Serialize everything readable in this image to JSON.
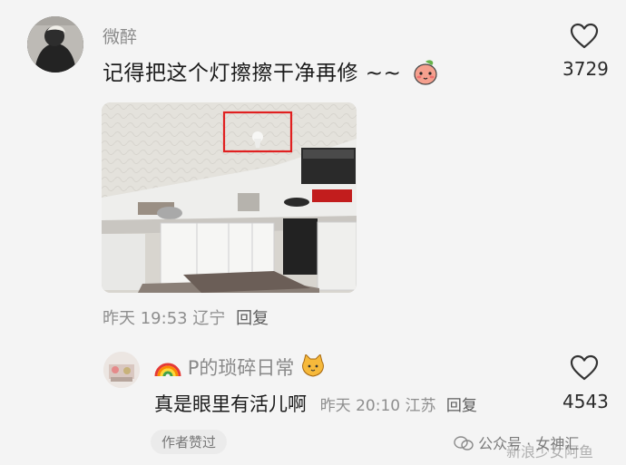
{
  "comment": {
    "username": "微醉",
    "text": "记得把这个灯擦擦干净再修 ~~",
    "likes": "3729",
    "time": "昨天 19:53 辽宁",
    "reply_label": "回复"
  },
  "reply": {
    "username": "P的琐碎日常",
    "text": "真是眼里有活儿啊",
    "time": "昨天 20:10 江苏",
    "reply_label": "回复",
    "likes": "4543",
    "author_liked_badge": "作者赞过"
  },
  "watermark": {
    "line1": "公众号 · 女神汇",
    "line2": "新浪少女阿鱼"
  },
  "icons": {
    "heart": "heart-outline-icon",
    "peach_emoji": "peach-emoji-icon",
    "rainbow_emoji": "rainbow-emoji-icon",
    "cat_emoji": "cat-emoji-icon"
  },
  "colors": {
    "highlight_box": "#e02020",
    "meta_text": "#8e8e8e"
  }
}
